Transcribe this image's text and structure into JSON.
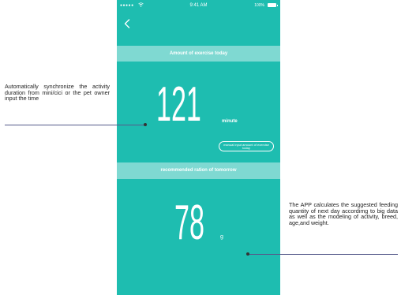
{
  "status_bar": {
    "signal": "●●●●● ",
    "time": "9:41 AM",
    "battery_text": "100%"
  },
  "header": {
    "back_icon": "chevron-left-icon"
  },
  "exercise": {
    "banner": "Amount of exercise today",
    "value": "121",
    "unit": "minute",
    "manual_button": "manual input amount of exercise today"
  },
  "ration": {
    "banner": "recommended ration of tomorrow",
    "value": "78",
    "unit": "g"
  },
  "annotations": {
    "left": "Automatically synchronize the activity duration from mini/cici or the pet owner input the time",
    "right": "The APP calculates the suggested feeding quantity of next day accordimg to big data as well as the modeling of activity, breed, age,and weight."
  },
  "colors": {
    "screen_bg": "#1ebdb0",
    "banner_bg": "#7fd9d2",
    "text": "#ffffff"
  }
}
